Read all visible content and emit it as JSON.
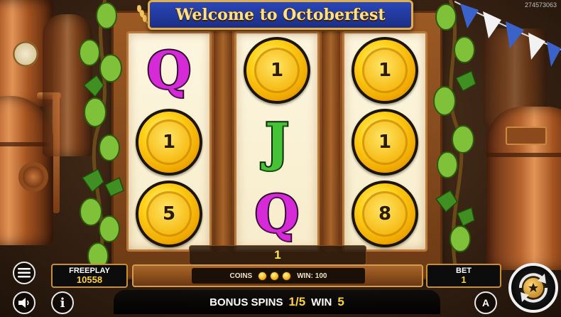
{
  "watermark": "274573063",
  "title": "Welcome to Octoberfest",
  "reels": [
    [
      {
        "kind": "letter",
        "symbol": "Q",
        "icon": "q-symbol-icon"
      },
      {
        "kind": "coin",
        "value": "1",
        "icon": "coin-symbol-icon"
      },
      {
        "kind": "coin",
        "value": "5",
        "icon": "coin-symbol-icon"
      }
    ],
    [
      {
        "kind": "coin",
        "value": "1",
        "icon": "coin-symbol-icon"
      },
      {
        "kind": "letter",
        "symbol": "J",
        "icon": "j-symbol-icon"
      },
      {
        "kind": "letter",
        "symbol": "Q",
        "icon": "q-symbol-icon"
      }
    ],
    [
      {
        "kind": "coin",
        "value": "1",
        "icon": "coin-symbol-icon"
      },
      {
        "kind": "coin",
        "value": "1",
        "icon": "coin-symbol-icon"
      },
      {
        "kind": "coin",
        "value": "8",
        "icon": "coin-symbol-icon"
      }
    ]
  ],
  "win_amount": "1",
  "info_bar": {
    "coins_label": "COINS",
    "win_label": "WIN: 100"
  },
  "freeplay": {
    "label": "FREEPLAY",
    "value": "10558"
  },
  "bet": {
    "label": "BET",
    "value": "1"
  },
  "bonus": {
    "label": "BONUS SPINS",
    "spins": "1/5",
    "win_label": "WIN",
    "win_value": "5"
  },
  "buttons": {
    "menu_icon": "hamburger-menu-icon",
    "sound_icon": "speaker-icon",
    "info_icon": "info-icon",
    "info_glyph": "i",
    "auto_icon": "autoplay-icon",
    "auto_glyph": "A",
    "spin_icon": "spin-arrows-icon"
  },
  "colors": {
    "title_banner": "#1c2f86",
    "accent_gold": "#ffd23a",
    "q_symbol": "#d62ad8",
    "j_symbol": "#46c237",
    "bunting": "#3b62c9"
  }
}
